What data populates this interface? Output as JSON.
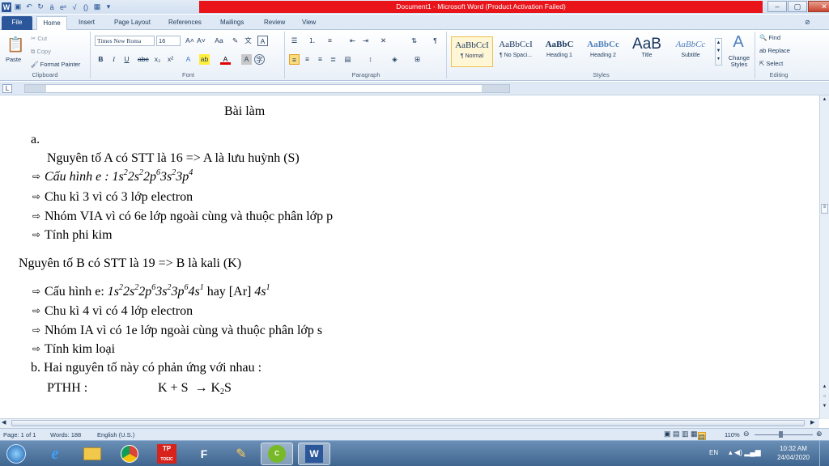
{
  "window": {
    "title": "Document1 - Microsoft Word (Product Activation Failed)"
  },
  "tabs": [
    "File",
    "Home",
    "Insert",
    "Page Layout",
    "References",
    "Mailings",
    "Review",
    "View"
  ],
  "ribbon": {
    "clipboard": {
      "label": "Clipboard",
      "paste": "Paste",
      "cut": "Cut",
      "copy": "Copy",
      "format_painter": "Format Painter"
    },
    "font": {
      "label": "Font",
      "font_name": "Times New Roma",
      "font_size": "16"
    },
    "paragraph": {
      "label": "Paragraph"
    },
    "styles": {
      "label": "Styles",
      "items": [
        {
          "sample": "AaBbCcI",
          "name": "¶ Normal"
        },
        {
          "sample": "AaBbCcI",
          "name": "¶ No Spaci..."
        },
        {
          "sample": "AaBbC",
          "name": "Heading 1"
        },
        {
          "sample": "AaBbCc",
          "name": "Heading 2"
        },
        {
          "sample": "AaB",
          "name": "Title"
        },
        {
          "sample": "AaBbCc",
          "name": "Subtitle"
        }
      ],
      "change_styles": "Change Styles"
    },
    "editing": {
      "label": "Editing",
      "find": "Find",
      "replace": "Replace",
      "select": "Select"
    }
  },
  "document": {
    "heading": "Bài làm",
    "a_label": "a.",
    "line1": "Nguyên tố A có STT là 16 => A là lưu huỳnh (S)",
    "line2_prefix": "Cấu hình e :",
    "line3": "Chu kì 3 vì có 3 lớp electron",
    "line4": "Nhóm VIA vì có 6e lớp ngoài cùng và thuộc phân lớp p",
    "line5": "Tính phi kim",
    "line6": "Nguyên tố B có STT là 19 => B là kali (K)",
    "line7_prefix": "Cấu hình e:",
    "line7_mid": "hay [Ar]",
    "line8": "Chu kì 4 vì có 4 lớp electron",
    "line9": "Nhóm IA vì có 1e lớp ngoài cùng và thuộc phân lớp s",
    "line10": "Tính kim loại",
    "line11": "b.  Hai nguyên tố này có phản ứng với nhau :",
    "line12_label": "PTHH :",
    "line12_eq": "K + S"
  },
  "status": {
    "page": "Page: 1 of 1",
    "words": "Words: 188",
    "lang": "English (U.S.)",
    "zoom": "110%"
  },
  "taskbar": {
    "lang": "EN",
    "time": "10:32 AM",
    "date": "24/04/2020",
    "tp_label": "TP",
    "tp_sub": "TOEIC"
  }
}
